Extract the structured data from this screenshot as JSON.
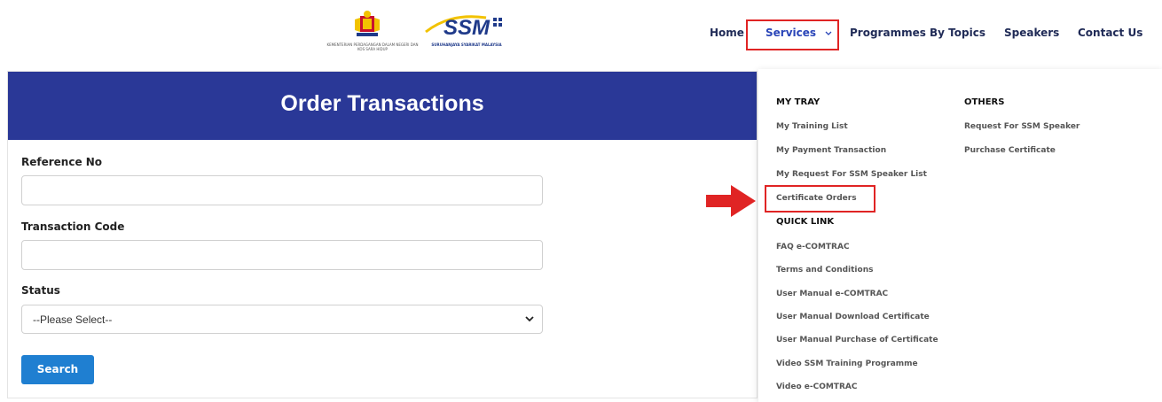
{
  "brand": {
    "crest_caption": "KEMENTERIAN PERDAGANGAN DALAM NEGERI DAN KOS SARA HIDUP",
    "ssm_caption": "SURUHANJAYA SYARIKAT MALAYSIA"
  },
  "nav": {
    "home": "Home",
    "services": "Services",
    "programmes": "Programmes By Topics",
    "speakers": "Speakers",
    "contact": "Contact Us"
  },
  "page": {
    "title": "Order Transactions"
  },
  "form": {
    "reference_label": "Reference No",
    "reference_value": "",
    "transaction_label": "Transaction Code",
    "transaction_value": "",
    "status_label": "Status",
    "status_selected": "--Please Select--",
    "search_label": "Search"
  },
  "dropdown": {
    "my_tray": {
      "heading": "MY TRAY",
      "items": [
        "My Training List",
        "My Payment Transaction",
        "My Request For SSM Speaker List",
        "Certificate Orders"
      ]
    },
    "quick_link": {
      "heading": "QUICK LINK",
      "items": [
        "FAQ e-COMTRAC",
        "Terms and Conditions",
        "User Manual e-COMTRAC",
        "User Manual Download Certificate",
        "User Manual Purchase of Certificate",
        "Video SSM Training Programme",
        "Video e-COMTRAC"
      ]
    },
    "others": {
      "heading": "OTHERS",
      "items": [
        "Request For SSM Speaker",
        "Purchase Certificate"
      ]
    }
  },
  "colors": {
    "header_blue": "#2a3897",
    "button_blue": "#1f7fd1",
    "annotation_red": "#e02424",
    "nav_text": "#1f2a56"
  }
}
